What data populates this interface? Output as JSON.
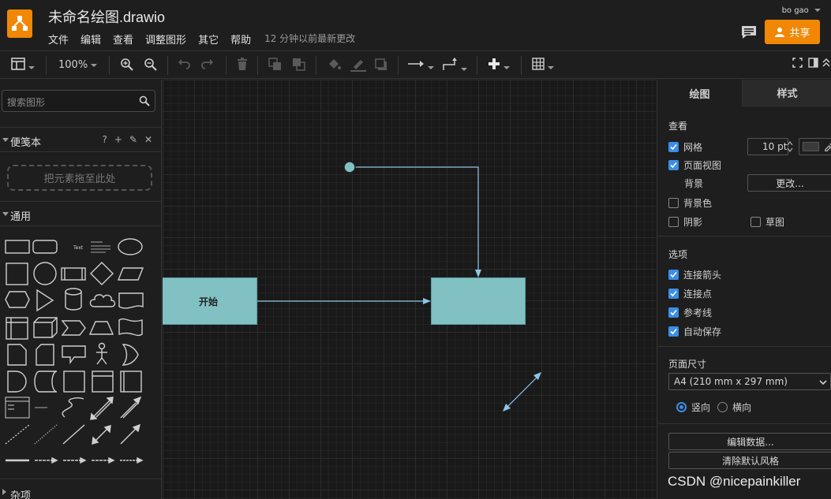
{
  "header": {
    "title": "未命名绘图.drawio",
    "menu": [
      "文件",
      "编辑",
      "查看",
      "调整图形",
      "其它",
      "帮助"
    ],
    "last_saved": "12 分钟以前最新更改",
    "user": "bo gao",
    "share_label": "共享",
    "brand_color": "#f08705"
  },
  "toolbar": {
    "zoom": "100%",
    "icons": [
      "format-panel-icon",
      "zoom-in-icon",
      "zoom-out-icon",
      "undo-icon",
      "redo-icon",
      "delete-icon",
      "to-front-icon",
      "to-back-icon",
      "fill-color-icon",
      "line-color-icon",
      "shadow-icon",
      "connection-icon",
      "waypoints-icon",
      "insert-icon",
      "table-icon",
      "fullscreen-icon",
      "format-toggle-icon",
      "collapse-icon"
    ]
  },
  "sidebar": {
    "search_placeholder": "搜索图形",
    "scratchpad_label": "便笺本",
    "scratchpad_tools": [
      "?",
      "+",
      "✎",
      "✕"
    ],
    "dropzone_label": "把元素拖至此处",
    "general_label": "通用",
    "misc_label": "杂项"
  },
  "canvas": {
    "start_label": "开始",
    "node_color": "#81c1c3",
    "edge_color": "#8ec5e6"
  },
  "format_panel": {
    "tabs": [
      "绘图",
      "样式"
    ],
    "view_section": "查看",
    "grid_label": "网格",
    "grid_checked": true,
    "grid_size": "10 pt",
    "page_view_label": "页面视图",
    "page_view_checked": true,
    "background_label": "背景",
    "change_button": "更改...",
    "background_color_label": "背景色",
    "background_color_checked": false,
    "shadow_label": "阴影",
    "shadow_checked": false,
    "sketch_label": "草图",
    "sketch_checked": false,
    "options_section": "选项",
    "options": [
      {
        "label": "连接箭头",
        "checked": true
      },
      {
        "label": "连接点",
        "checked": true
      },
      {
        "label": "参考线",
        "checked": true
      },
      {
        "label": "自动保存",
        "checked": true
      }
    ],
    "page_size_section": "页面尺寸",
    "page_size_value": "A4 (210 mm x 297 mm)",
    "portrait_label": "竖向",
    "portrait_selected": true,
    "landscape_label": "横向",
    "landscape_selected": false,
    "edit_data_button": "编辑数据...",
    "clear_style_button": "清除默认风格"
  },
  "watermark": "CSDN @nicepainkiller"
}
